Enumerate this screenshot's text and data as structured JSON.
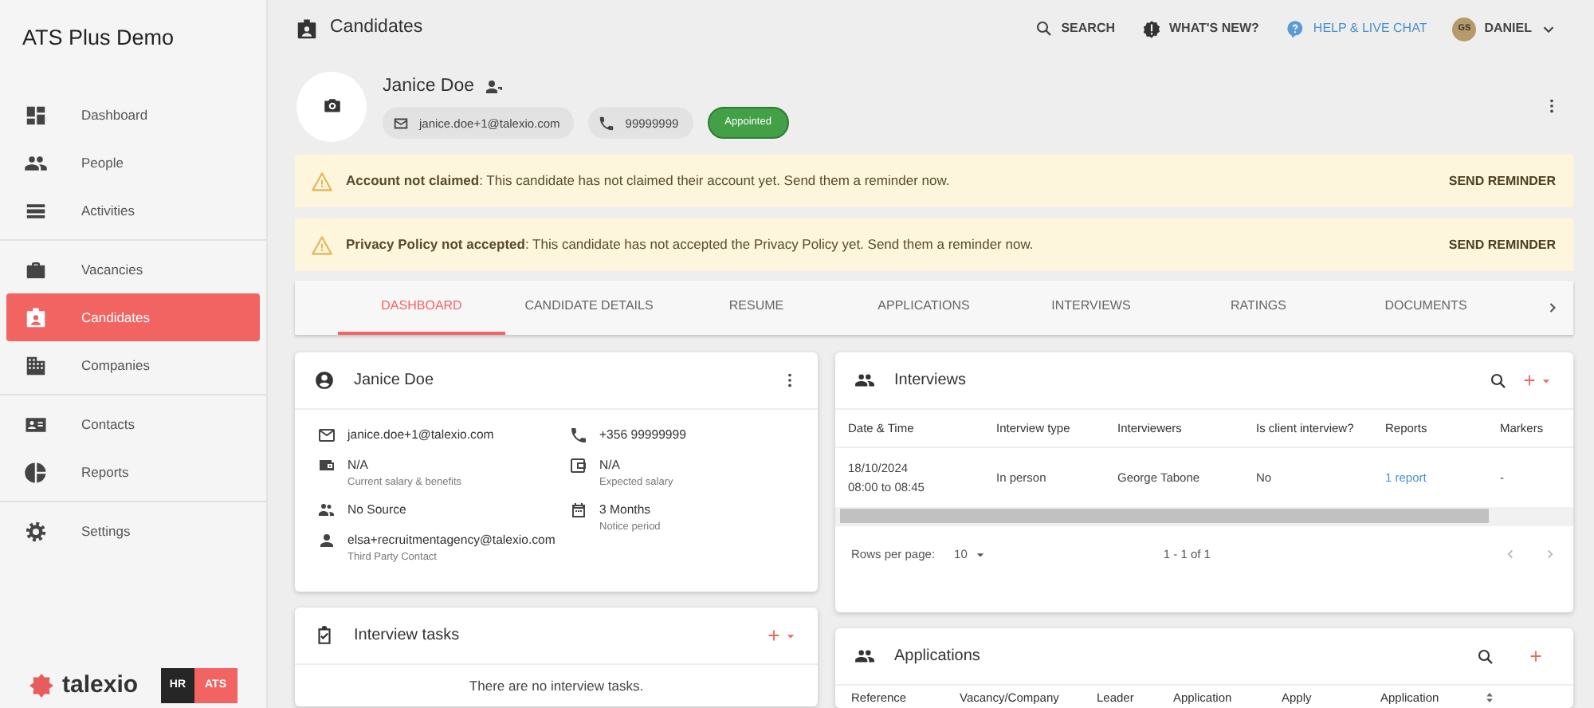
{
  "app_title": "ATS Plus Demo",
  "sidebar": {
    "groups": [
      {
        "items": [
          {
            "label": "Dashboard",
            "selected": false
          },
          {
            "label": "People",
            "selected": false
          },
          {
            "label": "Activities",
            "selected": false
          }
        ]
      },
      {
        "items": [
          {
            "label": "Vacancies",
            "selected": false
          },
          {
            "label": "Candidates",
            "selected": true
          },
          {
            "label": "Companies",
            "selected": false
          }
        ]
      },
      {
        "items": [
          {
            "label": "Contacts",
            "selected": false
          },
          {
            "label": "Reports",
            "selected": false
          }
        ]
      },
      {
        "items": [
          {
            "label": "Settings",
            "selected": false
          }
        ]
      }
    ]
  },
  "brand": {
    "logo": "talexio",
    "badge_left": "HR",
    "badge_right": "ATS"
  },
  "topbar": {
    "page_title": "Candidates",
    "search": "SEARCH",
    "whats_new": "WHAT'S NEW?",
    "help": "HELP & LIVE CHAT",
    "avatar_initials": "GS",
    "user": "DANIEL"
  },
  "candidate": {
    "name": "Janice Doe",
    "email": "janice.doe+1@talexio.com",
    "phone": "99999999",
    "status": "Appointed"
  },
  "alerts": [
    {
      "message": "**Account not claimed**: This candidate has not claimed their account yet. Send them a reminder now.",
      "action": "SEND REMINDER"
    },
    {
      "message": "**Privacy Policy not accepted**: This candidate has not accepted the Privacy Policy yet. Send them a reminder now.",
      "action": "SEND REMINDER"
    }
  ],
  "tabs": [
    {
      "label": "DASHBOARD",
      "selected": true
    },
    {
      "label": "CANDIDATE DETAILS",
      "selected": false
    },
    {
      "label": "RESUME",
      "selected": false
    },
    {
      "label": "APPLICATIONS",
      "selected": false
    },
    {
      "label": "INTERVIEWS",
      "selected": false
    },
    {
      "label": "RATINGS",
      "selected": false
    },
    {
      "label": "DOCUMENTS",
      "selected": false
    }
  ],
  "details_card": {
    "title": "Janice Doe",
    "left": [
      {
        "value": "janice.doe+1@talexio.com"
      },
      {
        "value": "N/A",
        "caption": "Current salary & benefits"
      },
      {
        "value": "No Source"
      },
      {
        "value": "elsa+recruitmentagency@talexio.com",
        "caption": "Third Party Contact"
      }
    ],
    "right": [
      {
        "value": "+356 99999999"
      },
      {
        "value": "N/A",
        "caption": "Expected salary"
      },
      {
        "value": "3 Months",
        "caption": "Notice period"
      }
    ]
  },
  "tasks_card": {
    "title": "Interview tasks",
    "empty": "There are no interview tasks."
  },
  "interviews": {
    "title": "Interviews",
    "columns": [
      "Date & Time",
      "Interview type",
      "Interviewers",
      "Is client interview?",
      "Reports",
      "Markers"
    ],
    "rows": [
      {
        "date": "18/10/2024",
        "time": "08:00 to 08:45",
        "type": "In person",
        "interviewers": "George Tabone",
        "client": "No",
        "reports": "1 report",
        "markers": "-"
      }
    ],
    "rows_per_page_label": "Rows per page:",
    "rows_per_page": "10",
    "range": "1 - 1 of 1"
  },
  "applications": {
    "title": "Applications",
    "columns": [
      "Reference",
      "Vacancy/Company",
      "Leader",
      "Application",
      "Apply",
      "Application"
    ]
  }
}
